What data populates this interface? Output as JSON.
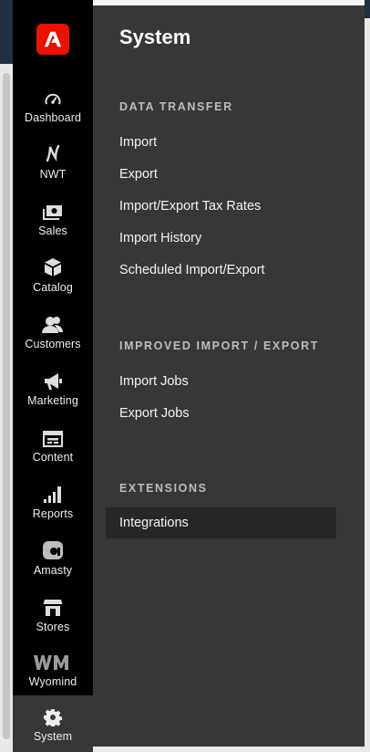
{
  "nav": {
    "items": [
      {
        "label": "Dashboard",
        "icon": "dashboard-icon"
      },
      {
        "label": "NWT",
        "icon": "nwt-icon"
      },
      {
        "label": "Sales",
        "icon": "sales-icon"
      },
      {
        "label": "Catalog",
        "icon": "catalog-icon"
      },
      {
        "label": "Customers",
        "icon": "customers-icon"
      },
      {
        "label": "Marketing",
        "icon": "marketing-icon"
      },
      {
        "label": "Content",
        "icon": "content-icon"
      },
      {
        "label": "Reports",
        "icon": "reports-icon"
      },
      {
        "label": "Amasty",
        "icon": "amasty-icon"
      },
      {
        "label": "Stores",
        "icon": "stores-icon"
      },
      {
        "label": "Wyomind",
        "icon": "wyomind-icon"
      },
      {
        "label": "System",
        "icon": "gear-icon",
        "active": true
      }
    ]
  },
  "submenu": {
    "title": "System",
    "sections": [
      {
        "title": "DATA TRANSFER",
        "links": [
          "Import",
          "Export",
          "Import/Export Tax Rates",
          "Import History",
          "Scheduled Import/Export"
        ]
      },
      {
        "title": "IMPROVED IMPORT / EXPORT",
        "links": [
          "Import Jobs",
          "Export Jobs"
        ]
      },
      {
        "title": "EXTENSIONS",
        "links": [
          "Integrations"
        ]
      }
    ]
  },
  "colors": {
    "sidebar_bg": "#000000",
    "submenu_bg": "#373737",
    "active_item_bg": "#272727",
    "brand_red": "#eb1000"
  }
}
